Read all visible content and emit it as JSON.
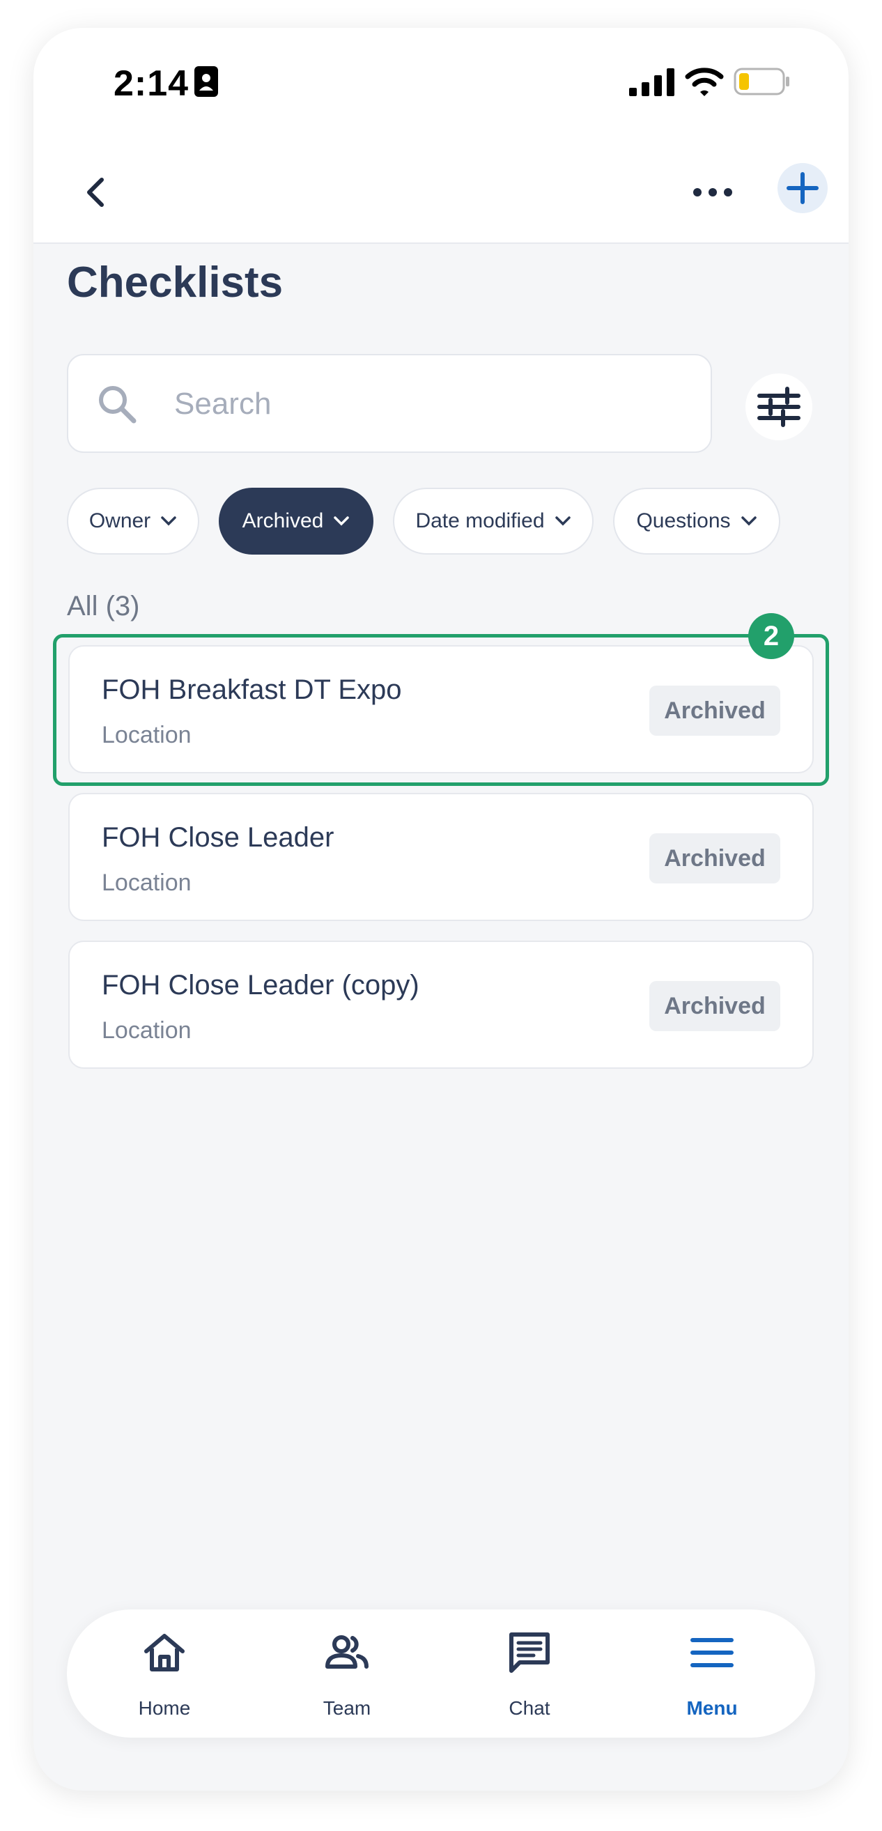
{
  "status_bar": {
    "time": "2:14"
  },
  "header": {
    "title": "Checklists"
  },
  "search": {
    "placeholder": "Search"
  },
  "filters": [
    {
      "label": "Owner",
      "active": false
    },
    {
      "label": "Archived",
      "active": true
    },
    {
      "label": "Date modified",
      "active": false
    },
    {
      "label": "Questions",
      "active": false
    }
  ],
  "list": {
    "count_label": "All (3)",
    "items": [
      {
        "title": "FOH Breakfast DT Expo",
        "subtitle": "Location",
        "tag": "Archived"
      },
      {
        "title": "FOH Close Leader",
        "subtitle": "Location",
        "tag": "Archived"
      },
      {
        "title": "FOH Close Leader (copy)",
        "subtitle": "Location",
        "tag": "Archived"
      }
    ]
  },
  "highlight": {
    "number": "2"
  },
  "tabbar": {
    "tabs": [
      {
        "label": "Home",
        "icon": "home-icon",
        "active": false
      },
      {
        "label": "Team",
        "icon": "team-icon",
        "active": false
      },
      {
        "label": "Chat",
        "icon": "chat-icon",
        "active": false
      },
      {
        "label": "Menu",
        "icon": "menu-icon",
        "active": true
      }
    ]
  },
  "colors": {
    "primary_dark": "#2c3a57",
    "accent_blue": "#1565c0",
    "highlight_green": "#22a06b",
    "background": "#f5f6f8"
  }
}
